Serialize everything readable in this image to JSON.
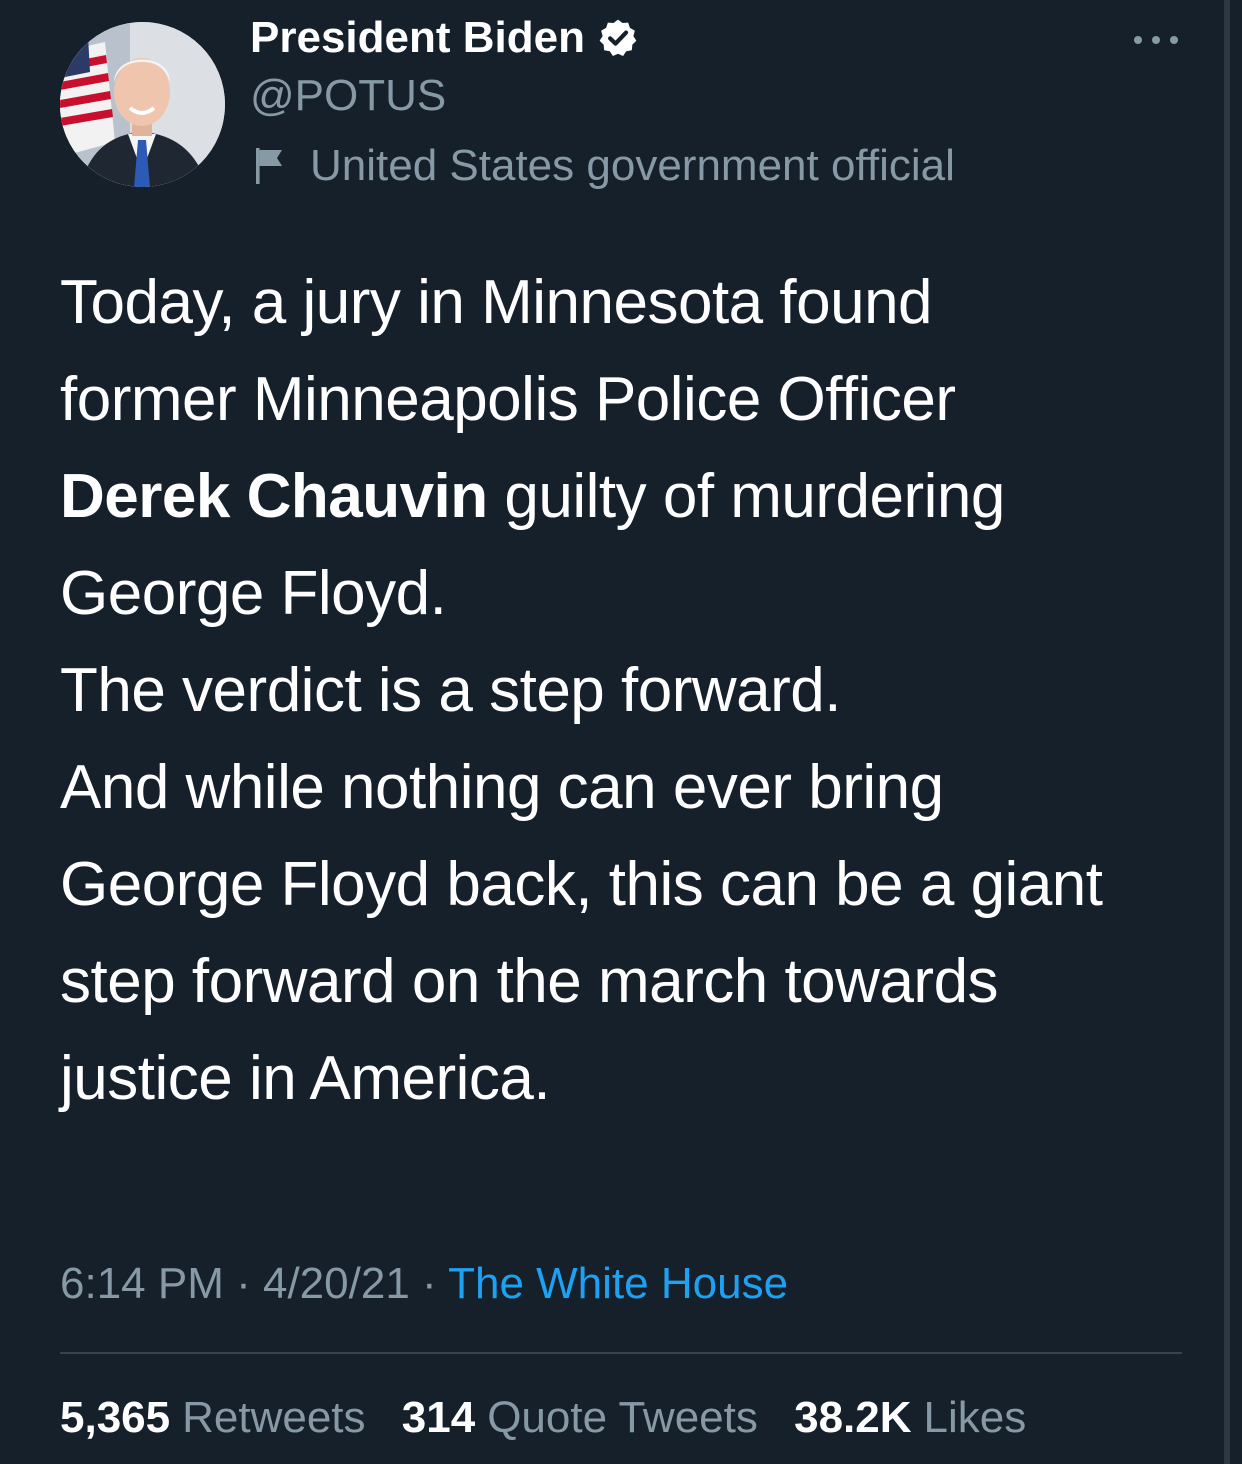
{
  "author": {
    "display_name": "President Biden",
    "handle": "@POTUS",
    "label": "United States government official",
    "verified": true
  },
  "tweet": {
    "line1": "Today, a jury in Minnesota found",
    "line2": "former Minneapolis Police Officer",
    "bold_name": "Derek Chauvin",
    "line3_rest": " guilty of murdering",
    "line4": "George Floyd.",
    "para2": "The verdict is a step forward.",
    "para3_line1": "And while nothing can ever bring",
    "para3_line2": "George Floyd back, this can be a giant",
    "para3_line3": "step forward on the march towards",
    "para3_line4": "justice in America."
  },
  "meta": {
    "time": "6:14 PM",
    "separator": " · ",
    "date": "4/20/21",
    "source": "The White House"
  },
  "stats": {
    "retweets_count": "5,365",
    "retweets_label": "Retweets",
    "quotes_count": "314",
    "quotes_label": "Quote Tweets",
    "likes_count": "38.2K",
    "likes_label": "Likes"
  },
  "colors": {
    "background": "#15202b",
    "text": "#ffffff",
    "secondary": "#8899a6",
    "link": "#1da1f2"
  },
  "icons": {
    "verified": "verified-badge-icon",
    "label": "flag-icon",
    "more": "more-options-icon"
  }
}
